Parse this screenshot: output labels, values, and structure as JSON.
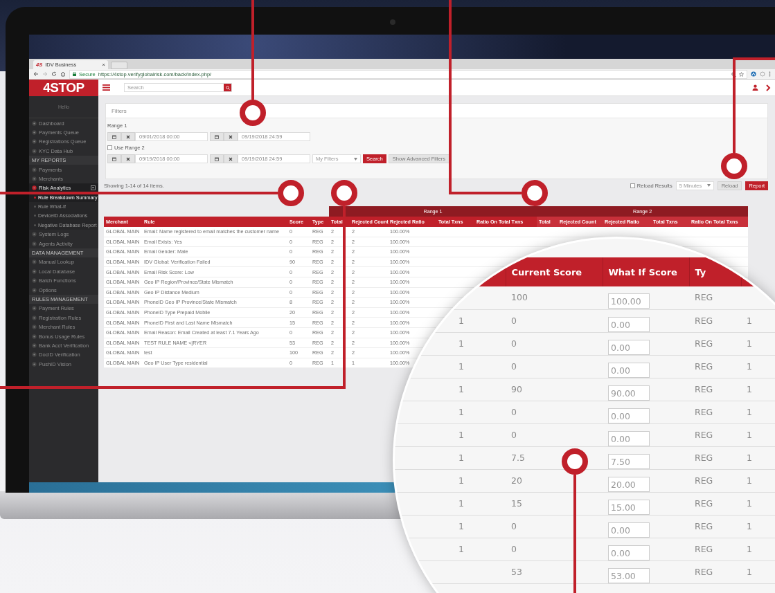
{
  "browser": {
    "favicon": "4S",
    "tab_title": "IDV Business",
    "tab_close": "×",
    "secure_label": "Secure",
    "url": "https://4stop.verifyglobalrisk.com/back/index.php/"
  },
  "app": {
    "logo": "4STOP",
    "search_placeholder": "Search",
    "greeting": "Hello"
  },
  "sidebar": {
    "items": [
      {
        "kind": "item",
        "label": "Dashboard",
        "selected": false
      },
      {
        "kind": "item",
        "label": "Payments Queue",
        "selected": false
      },
      {
        "kind": "item",
        "label": "Registrations Queue",
        "selected": false
      },
      {
        "kind": "item",
        "label": "KYC Data Hub",
        "selected": false
      },
      {
        "kind": "section",
        "label": "MY REPORTS"
      },
      {
        "kind": "item",
        "label": "Payments",
        "selected": false
      },
      {
        "kind": "item",
        "label": "Merchants",
        "selected": false
      },
      {
        "kind": "item",
        "label": "Risk Analytics",
        "selected": true,
        "expanded": true,
        "children": [
          {
            "label": "Rule Breakdown Summary",
            "selected": true
          },
          {
            "label": "Rule What-If",
            "selected": false
          },
          {
            "label": "DeviceID Associations",
            "selected": false
          },
          {
            "label": "Negative Database Report",
            "selected": false
          }
        ]
      },
      {
        "kind": "item",
        "label": "System Logs",
        "selected": false
      },
      {
        "kind": "item",
        "label": "Agents Activity",
        "selected": false
      },
      {
        "kind": "section",
        "label": "DATA MANAGEMENT"
      },
      {
        "kind": "item",
        "label": "Manual Lookup",
        "selected": false
      },
      {
        "kind": "item",
        "label": "Local Database",
        "selected": false
      },
      {
        "kind": "item",
        "label": "Batch Functions",
        "selected": false
      },
      {
        "kind": "item",
        "label": "Options",
        "selected": false
      },
      {
        "kind": "section",
        "label": "RULES MANAGEMENT"
      },
      {
        "kind": "item",
        "label": "Payment Rules",
        "selected": false
      },
      {
        "kind": "item",
        "label": "Registration Rules",
        "selected": false
      },
      {
        "kind": "item",
        "label": "Merchant Rules",
        "selected": false
      },
      {
        "kind": "item",
        "label": "Bonus Usage Rules",
        "selected": false
      },
      {
        "kind": "item",
        "label": "Bank Acct Verification",
        "selected": false
      },
      {
        "kind": "item",
        "label": "DocID Verification",
        "selected": false
      },
      {
        "kind": "item",
        "label": "PushID Vision",
        "selected": false
      }
    ]
  },
  "filters": {
    "title": "Filters",
    "range_1": {
      "label": "Range 1",
      "from": "09/01/2018 00:00",
      "to": "09/19/2018 24:59"
    },
    "use_range_2": {
      "label": "Use Range 2",
      "checked": false
    },
    "range_2": {
      "from": "09/19/2018 00:00",
      "to": "09/19/2018 24:59"
    },
    "saved_filter": "My Filters",
    "search_button": "Search",
    "advanced_button": "Show Advanced Filters"
  },
  "results": {
    "summary": "Showing 1-14 of 14 items.",
    "auto_reload": {
      "label": "Reload Results",
      "checked": false
    },
    "interval": "5 Minutes",
    "reload_button": "Reload",
    "report_button": "Report"
  },
  "table": {
    "columns": [
      "Merchant",
      "Rule",
      "Score",
      "Type"
    ],
    "groups": [
      "Range 1",
      "Range 2"
    ],
    "range_1_columns": [
      "Total",
      "Rejected Count",
      "Rejected Ratio",
      "Total Txns",
      "Ratio On Total Txns"
    ],
    "range_2_columns": [
      "Total",
      "Rejected Count",
      "Rejected Ratio",
      "Total Txns",
      "Ratio On Total Txns"
    ],
    "rows": [
      {
        "merchant": "GLOBAL MAIN",
        "rule": "Email: Name registered to email matches the customer name",
        "score": "0",
        "type": "REG",
        "total": "2",
        "rejected_count": "2",
        "rejected_ratio": "100.00%"
      },
      {
        "merchant": "GLOBAL MAIN",
        "rule": "Email Exists: Yes",
        "score": "0",
        "type": "REG",
        "total": "2",
        "rejected_count": "2",
        "rejected_ratio": "100.00%"
      },
      {
        "merchant": "GLOBAL MAIN",
        "rule": "Email Gender: Male",
        "score": "0",
        "type": "REG",
        "total": "2",
        "rejected_count": "2",
        "rejected_ratio": "100.00%"
      },
      {
        "merchant": "GLOBAL MAIN",
        "rule": "IDV Global: Verification Failed",
        "score": "90",
        "type": "REG",
        "total": "2",
        "rejected_count": "2",
        "rejected_ratio": "100.00%"
      },
      {
        "merchant": "GLOBAL MAIN",
        "rule": "Email Risk Score: Low",
        "score": "0",
        "type": "REG",
        "total": "2",
        "rejected_count": "2",
        "rejected_ratio": "100.00%"
      },
      {
        "merchant": "GLOBAL MAIN",
        "rule": "Geo IP Region/Province/State Mismatch",
        "score": "0",
        "type": "REG",
        "total": "2",
        "rejected_count": "2",
        "rejected_ratio": "100.00%"
      },
      {
        "merchant": "GLOBAL MAIN",
        "rule": "Geo IP Distance Medium",
        "score": "0",
        "type": "REG",
        "total": "2",
        "rejected_count": "2",
        "rejected_ratio": "100.00%"
      },
      {
        "merchant": "GLOBAL MAIN",
        "rule": "PhoneID Geo IP Province/State Mismatch",
        "score": "8",
        "type": "REG",
        "total": "2",
        "rejected_count": "2",
        "rejected_ratio": "100.00%"
      },
      {
        "merchant": "GLOBAL MAIN",
        "rule": "PhoneID Type Prepaid Mobile",
        "score": "20",
        "type": "REG",
        "total": "2",
        "rejected_count": "2",
        "rejected_ratio": "100.00%"
      },
      {
        "merchant": "GLOBAL MAIN",
        "rule": "PhoneID First and Last Name Mismatch",
        "score": "15",
        "type": "REG",
        "total": "2",
        "rejected_count": "2",
        "rejected_ratio": "100.00%"
      },
      {
        "merchant": "GLOBAL MAIN",
        "rule": "Email Reason: Email Created at least 7.1 Years Ago",
        "score": "0",
        "type": "REG",
        "total": "2",
        "rejected_count": "2",
        "rejected_ratio": "100.00%"
      },
      {
        "merchant": "GLOBAL MAIN",
        "rule": "TEST RULE NAME <|RYER",
        "score": "53",
        "type": "REG",
        "total": "2",
        "rejected_count": "2",
        "rejected_ratio": "100.00%"
      },
      {
        "merchant": "GLOBAL MAIN",
        "rule": "test",
        "score": "100",
        "type": "REG",
        "total": "2",
        "rejected_count": "2",
        "rejected_ratio": "100.00%"
      },
      {
        "merchant": "GLOBAL MAIN",
        "rule": "Geo IP User Type residential",
        "score": "0",
        "type": "REG",
        "total": "1",
        "rejected_count": "1",
        "rejected_ratio": "100.00%"
      }
    ]
  },
  "magnifier": {
    "columns": [
      "Current Score",
      "What If Score",
      "Ty"
    ],
    "rows": [
      {
        "current_score": "100",
        "what_if_score": "100.00",
        "type": "REG"
      },
      {
        "column_1": "1",
        "current_score": "0",
        "what_if_score": "0.00",
        "type": "REG",
        "column_5": "1"
      },
      {
        "column_1": "1",
        "current_score": "0",
        "what_if_score": "0.00",
        "type": "REG",
        "column_5": "1"
      },
      {
        "column_1": "1",
        "current_score": "0",
        "what_if_score": "0.00",
        "type": "REG",
        "column_5": "1"
      },
      {
        "column_1": "1",
        "current_score": "90",
        "what_if_score": "90.00",
        "type": "REG",
        "column_5": "1"
      },
      {
        "column_1": "1",
        "current_score": "0",
        "what_if_score": "0.00",
        "type": "REG",
        "column_5": "1"
      },
      {
        "column_1": "1",
        "current_score": "0",
        "what_if_score": "0.00",
        "type": "REG",
        "column_5": "1"
      },
      {
        "column_1": "1",
        "current_score": "7.5",
        "what_if_score": "7.50",
        "type": "REG",
        "column_5": "1"
      },
      {
        "column_1": "1",
        "current_score": "20",
        "what_if_score": "20.00",
        "type": "REG",
        "column_5": "1"
      },
      {
        "column_1": "1",
        "current_score": "15",
        "what_if_score": "15.00",
        "type": "REG",
        "column_5": "1"
      },
      {
        "column_1": "1",
        "current_score": "0",
        "what_if_score": "0.00",
        "type": "REG",
        "column_5": "1"
      },
      {
        "column_1": "1",
        "current_score": "0",
        "what_if_score": "0.00",
        "type": "REG",
        "column_5": "1"
      },
      {
        "current_score": "53",
        "what_if_score": "53.00",
        "type": "REG",
        "column_5": "1"
      }
    ]
  }
}
